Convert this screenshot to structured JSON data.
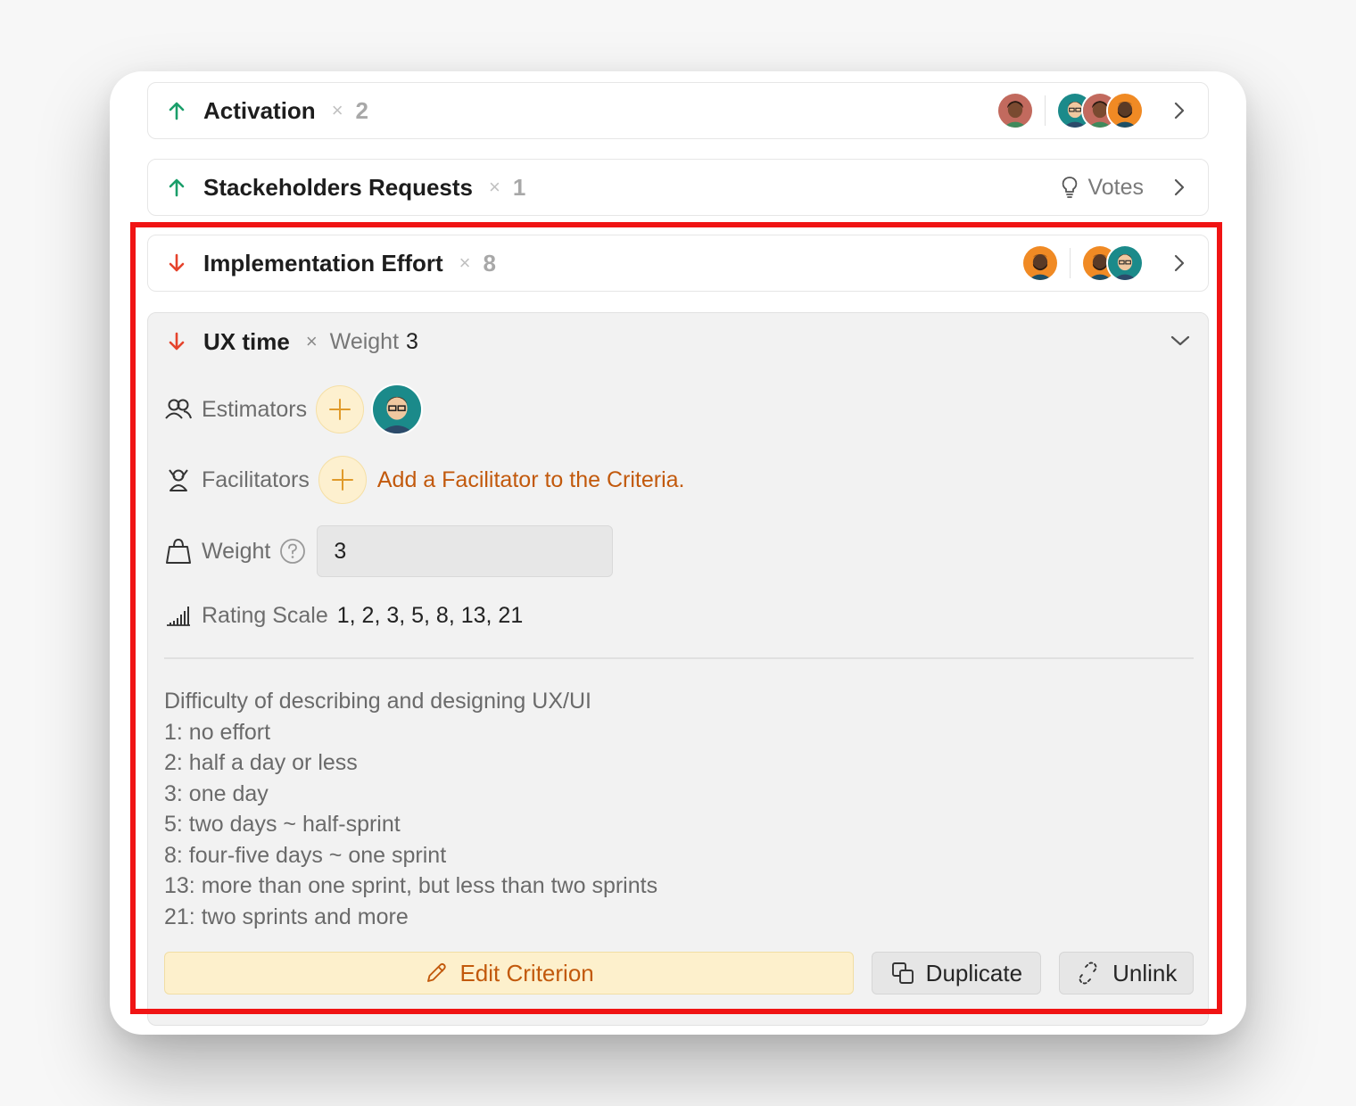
{
  "criteria": [
    {
      "direction": "up",
      "title": "Activation",
      "times": "×",
      "multiplier": "2",
      "right": "avatars"
    },
    {
      "direction": "up",
      "title": "Stackeholders Requests",
      "times": "×",
      "multiplier": "1",
      "right": "votes",
      "votes_label": "Votes"
    },
    {
      "direction": "down",
      "title": "Implementation Effort",
      "times": "×",
      "multiplier": "8",
      "right": "avatars"
    }
  ],
  "expanded": {
    "direction": "down",
    "title": "UX time",
    "times": "×",
    "weight_label": "Weight",
    "weight_value": "3",
    "estimators_label": "Estimators",
    "facilitators_label": "Facilitators",
    "add_facilitator_text": "Add a Facilitator to the Criteria.",
    "weight_field_label": "Weight",
    "weight_input_value": "3",
    "rating_scale_label": "Rating Scale",
    "rating_scale_values": "1, 2, 3, 5, 8, 13, 21",
    "description": [
      "Difficulty of describing and designing UX/UI",
      "1: no effort",
      "2: half a day or less",
      "3: one day",
      "5: two days ~ half-sprint",
      "8: four-five days ~ one sprint",
      "13: more than one sprint, but less than two sprints",
      "21: two sprints and more"
    ],
    "buttons": {
      "edit": "Edit Criterion",
      "duplicate": "Duplicate",
      "unlink": "Unlink"
    }
  },
  "colors": {
    "up_arrow": "#1a9e6a",
    "down_arrow": "#e5432c",
    "accent": "#c2590c",
    "highlight": "#f01414"
  },
  "icons": [
    "arrow-up-icon",
    "arrow-down-icon",
    "chevron-right-icon",
    "chevron-down-icon",
    "lightbulb-icon",
    "users-icon",
    "facilitator-icon",
    "weight-icon",
    "help-icon",
    "signal-bars-icon",
    "plus-icon",
    "pencil-icon",
    "duplicate-icon",
    "unlink-icon"
  ]
}
